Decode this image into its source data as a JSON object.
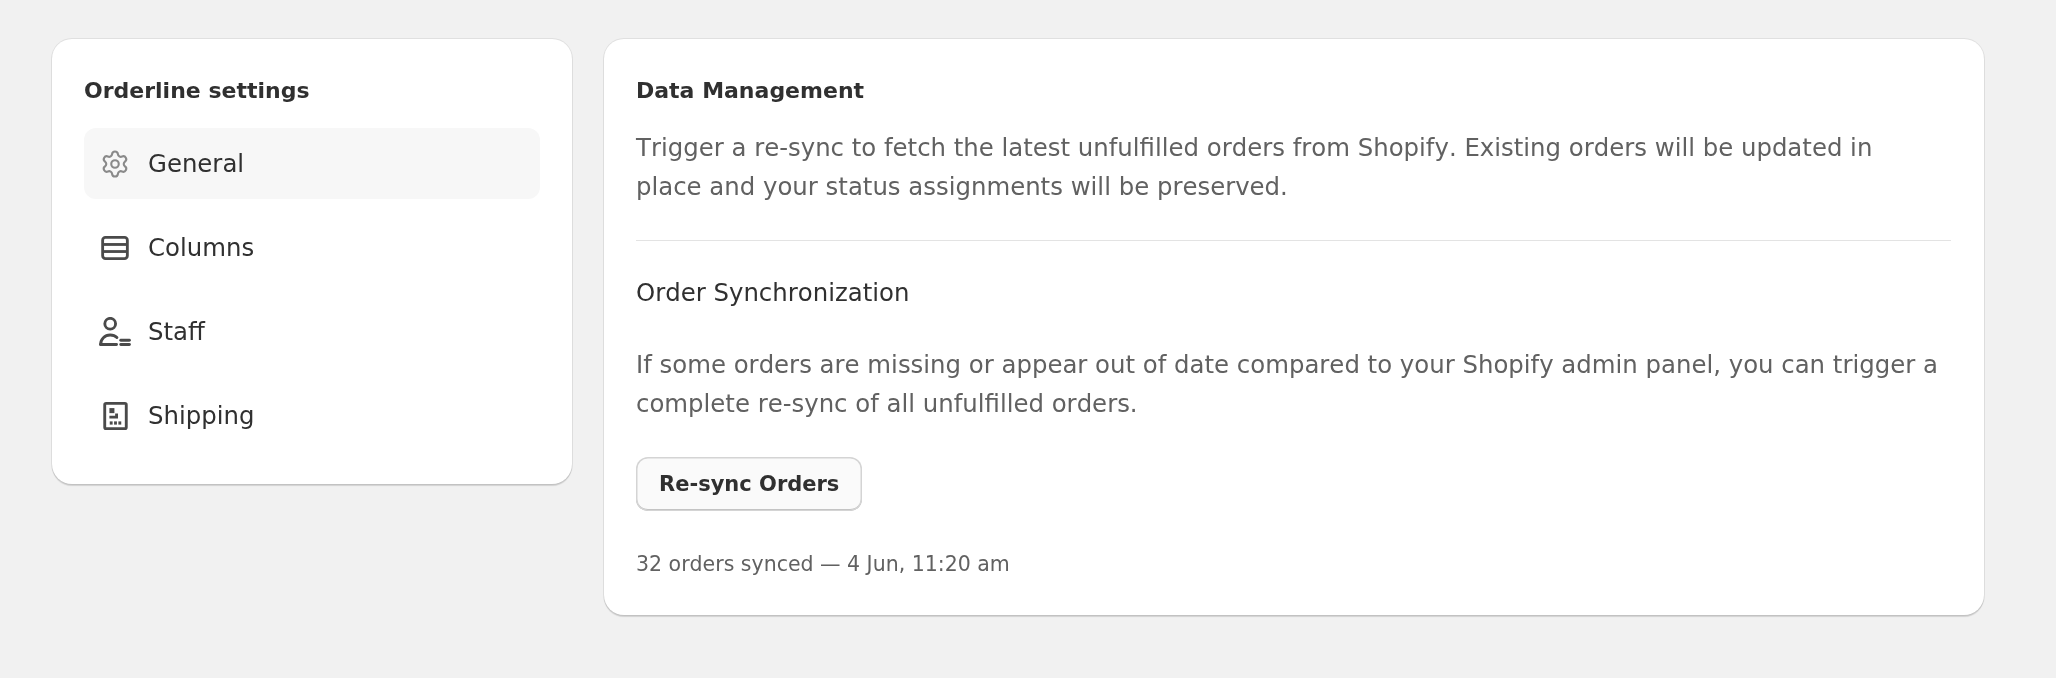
{
  "sidebar": {
    "title": "Orderline settings",
    "items": [
      {
        "label": "General",
        "selected": true
      },
      {
        "label": "Columns",
        "selected": false
      },
      {
        "label": "Staff",
        "selected": false
      },
      {
        "label": "Shipping",
        "selected": false
      }
    ]
  },
  "data_management": {
    "title": "Data Management",
    "description": "Trigger a re-sync to fetch the latest unfulfilled orders from Shopify. Existing orders will be updated in place and your status assignments will be preserved.",
    "order_sync": {
      "title": "Order Synchronization",
      "description": "If some orders are missing or appear out of date compared to your Shopify admin panel, you can trigger a complete re-sync of all unfulfilled orders.",
      "button": "Re-sync Orders",
      "status": "32 orders synced — 4 Jun, 11:20 am"
    }
  }
}
